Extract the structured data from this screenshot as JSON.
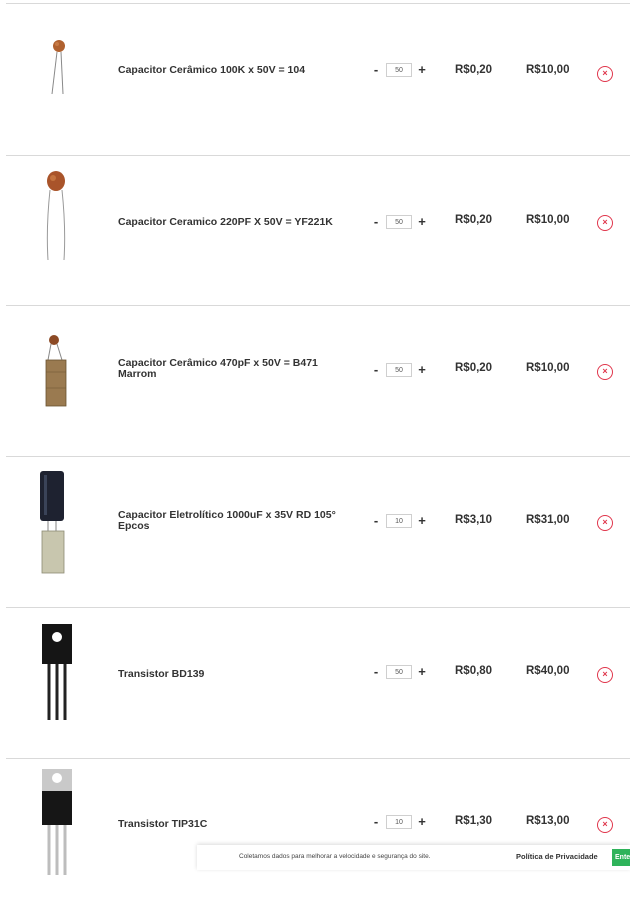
{
  "cart": {
    "items": [
      {
        "name": "Capacitor Cerâmico 100K x 50V = 104",
        "quantity": "50",
        "unit_price": "R$0,20",
        "total": "R$10,00",
        "remove_symbol": "×"
      },
      {
        "name": "Capacitor Ceramico 220PF X 50V = YF221K",
        "quantity": "50",
        "unit_price": "R$0,20",
        "total": "R$10,00",
        "remove_symbol": "×"
      },
      {
        "name": "Capacitor Cerâmico 470pF x 50V = B471 Marrom",
        "quantity": "50",
        "unit_price": "R$0,20",
        "total": "R$10,00",
        "remove_symbol": "×"
      },
      {
        "name": "Capacitor Eletrolítico 1000uF x 35V RD 105° Epcos",
        "quantity": "10",
        "unit_price": "R$3,10",
        "total": "R$31,00",
        "remove_symbol": "×"
      },
      {
        "name": "Transistor BD139",
        "quantity": "50",
        "unit_price": "R$0,80",
        "total": "R$40,00",
        "remove_symbol": "×"
      },
      {
        "name": "Transistor TIP31C",
        "quantity": "10",
        "unit_price": "R$1,30",
        "total": "R$13,00",
        "remove_symbol": "×"
      }
    ],
    "minus_label": "-",
    "plus_label": "+"
  },
  "cookie_bar": {
    "message": "Coletamos dados para melhorar a velocidade e segurança do site.",
    "policy_link": "Política de Privacidade",
    "button_label": "Entendi"
  },
  "colors": {
    "remove_accent": "#e0364c",
    "cookie_button": "#2eb35a",
    "divider": "#d9d9d9"
  }
}
